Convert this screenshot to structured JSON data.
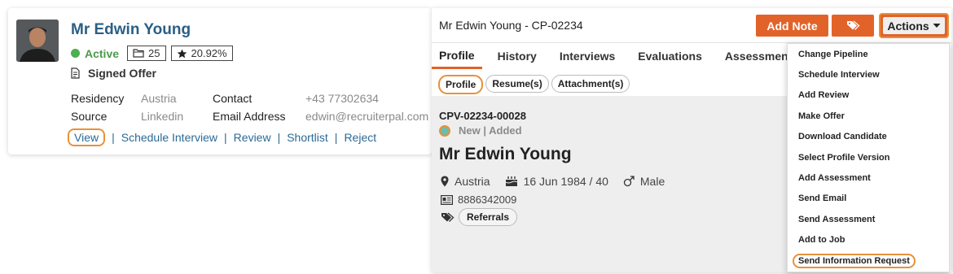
{
  "candidate_card": {
    "name": "Mr Edwin Young",
    "status": "Active",
    "folder_count": "25",
    "rating": "20.92%",
    "offer_status": "Signed Offer",
    "residency_label": "Residency",
    "residency_value": "Austria",
    "contact_label": "Contact",
    "contact_value": "+43 77302634",
    "source_label": "Source",
    "source_value": "Linkedin",
    "email_label": "Email Address",
    "email_value": "edwin@recruiterpal.com",
    "links": {
      "view": "View",
      "schedule": "Schedule Interview",
      "review": "Review",
      "shortlist": "Shortlist",
      "reject": "Reject"
    }
  },
  "panel": {
    "title": "Mr Edwin Young - CP-02234",
    "add_note": "Add Note",
    "actions": "Actions",
    "tabs": [
      "Profile",
      "History",
      "Interviews",
      "Evaluations",
      "Assessments"
    ],
    "subtabs": [
      "Profile",
      "Resume(s)",
      "Attachment(s)"
    ],
    "profile": {
      "code": "CPV-02234-00028",
      "state": "New | Added",
      "name": "Mr Edwin Young",
      "location": "Austria",
      "birth": "16 Jun 1984 / 40",
      "gender": "Male",
      "phone": "8886342009",
      "tag": "Referrals"
    }
  },
  "actions_menu": [
    "Change Pipeline",
    "Schedule Interview",
    "Add Review",
    "Make Offer",
    "Download Candidate",
    "Select Profile Version",
    "Add Assessment",
    "Send Email",
    "Send Assessment",
    "Add to Job",
    "Send Information Request"
  ],
  "colors": {
    "accent_orange": "#e2632a",
    "highlight_ring": "#e8913a",
    "link_blue": "#2a6a96",
    "active_green": "#4caf50"
  }
}
